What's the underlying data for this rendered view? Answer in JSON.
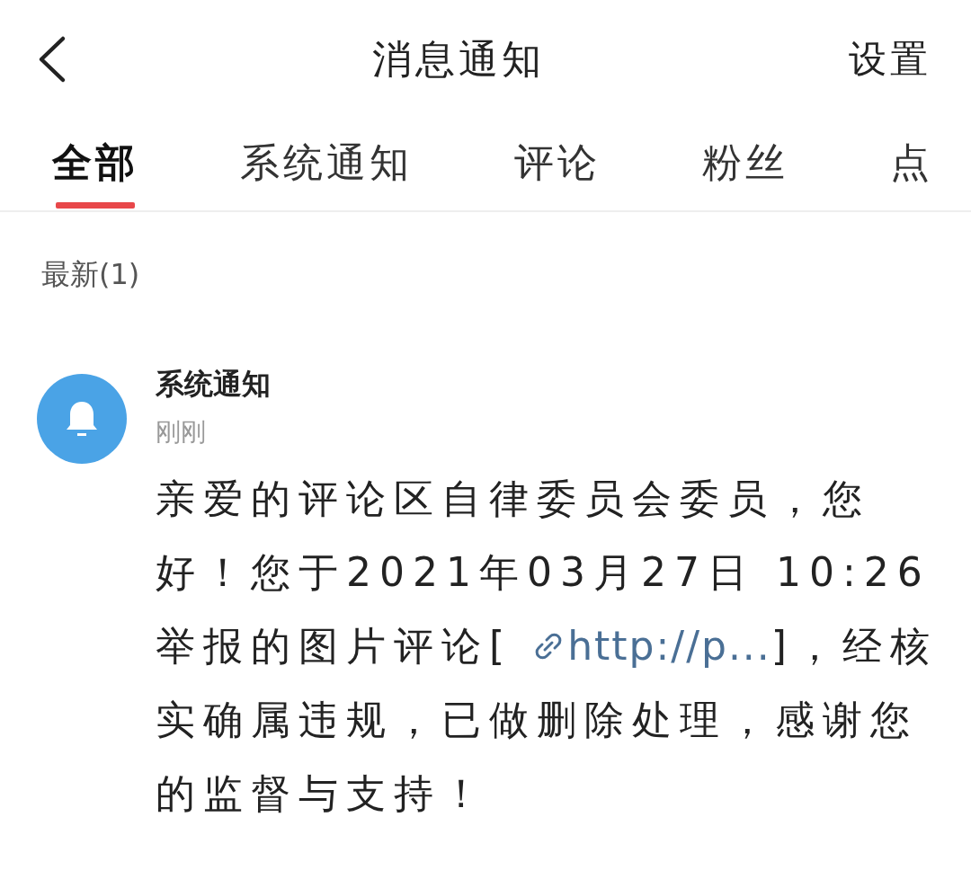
{
  "header": {
    "title": "消息通知",
    "action": "设置"
  },
  "tabs": [
    {
      "label": "全部",
      "selected": true
    },
    {
      "label": "系统通知",
      "selected": false
    },
    {
      "label": "评论",
      "selected": false
    },
    {
      "label": "粉丝",
      "selected": false
    },
    {
      "label": "点",
      "selected": false
    }
  ],
  "section": {
    "label": "最新(1)"
  },
  "notifications": [
    {
      "sender": "系统通知",
      "time": "刚刚",
      "text_before": "亲爱的评论区自律委员会委员，您好！您于2021年03月27日 10:26举报的图片评论[ ",
      "link": "http://p...",
      "text_after": "]，经核实确属违规，已做删除处理，感谢您的监督与支持！"
    }
  ]
}
